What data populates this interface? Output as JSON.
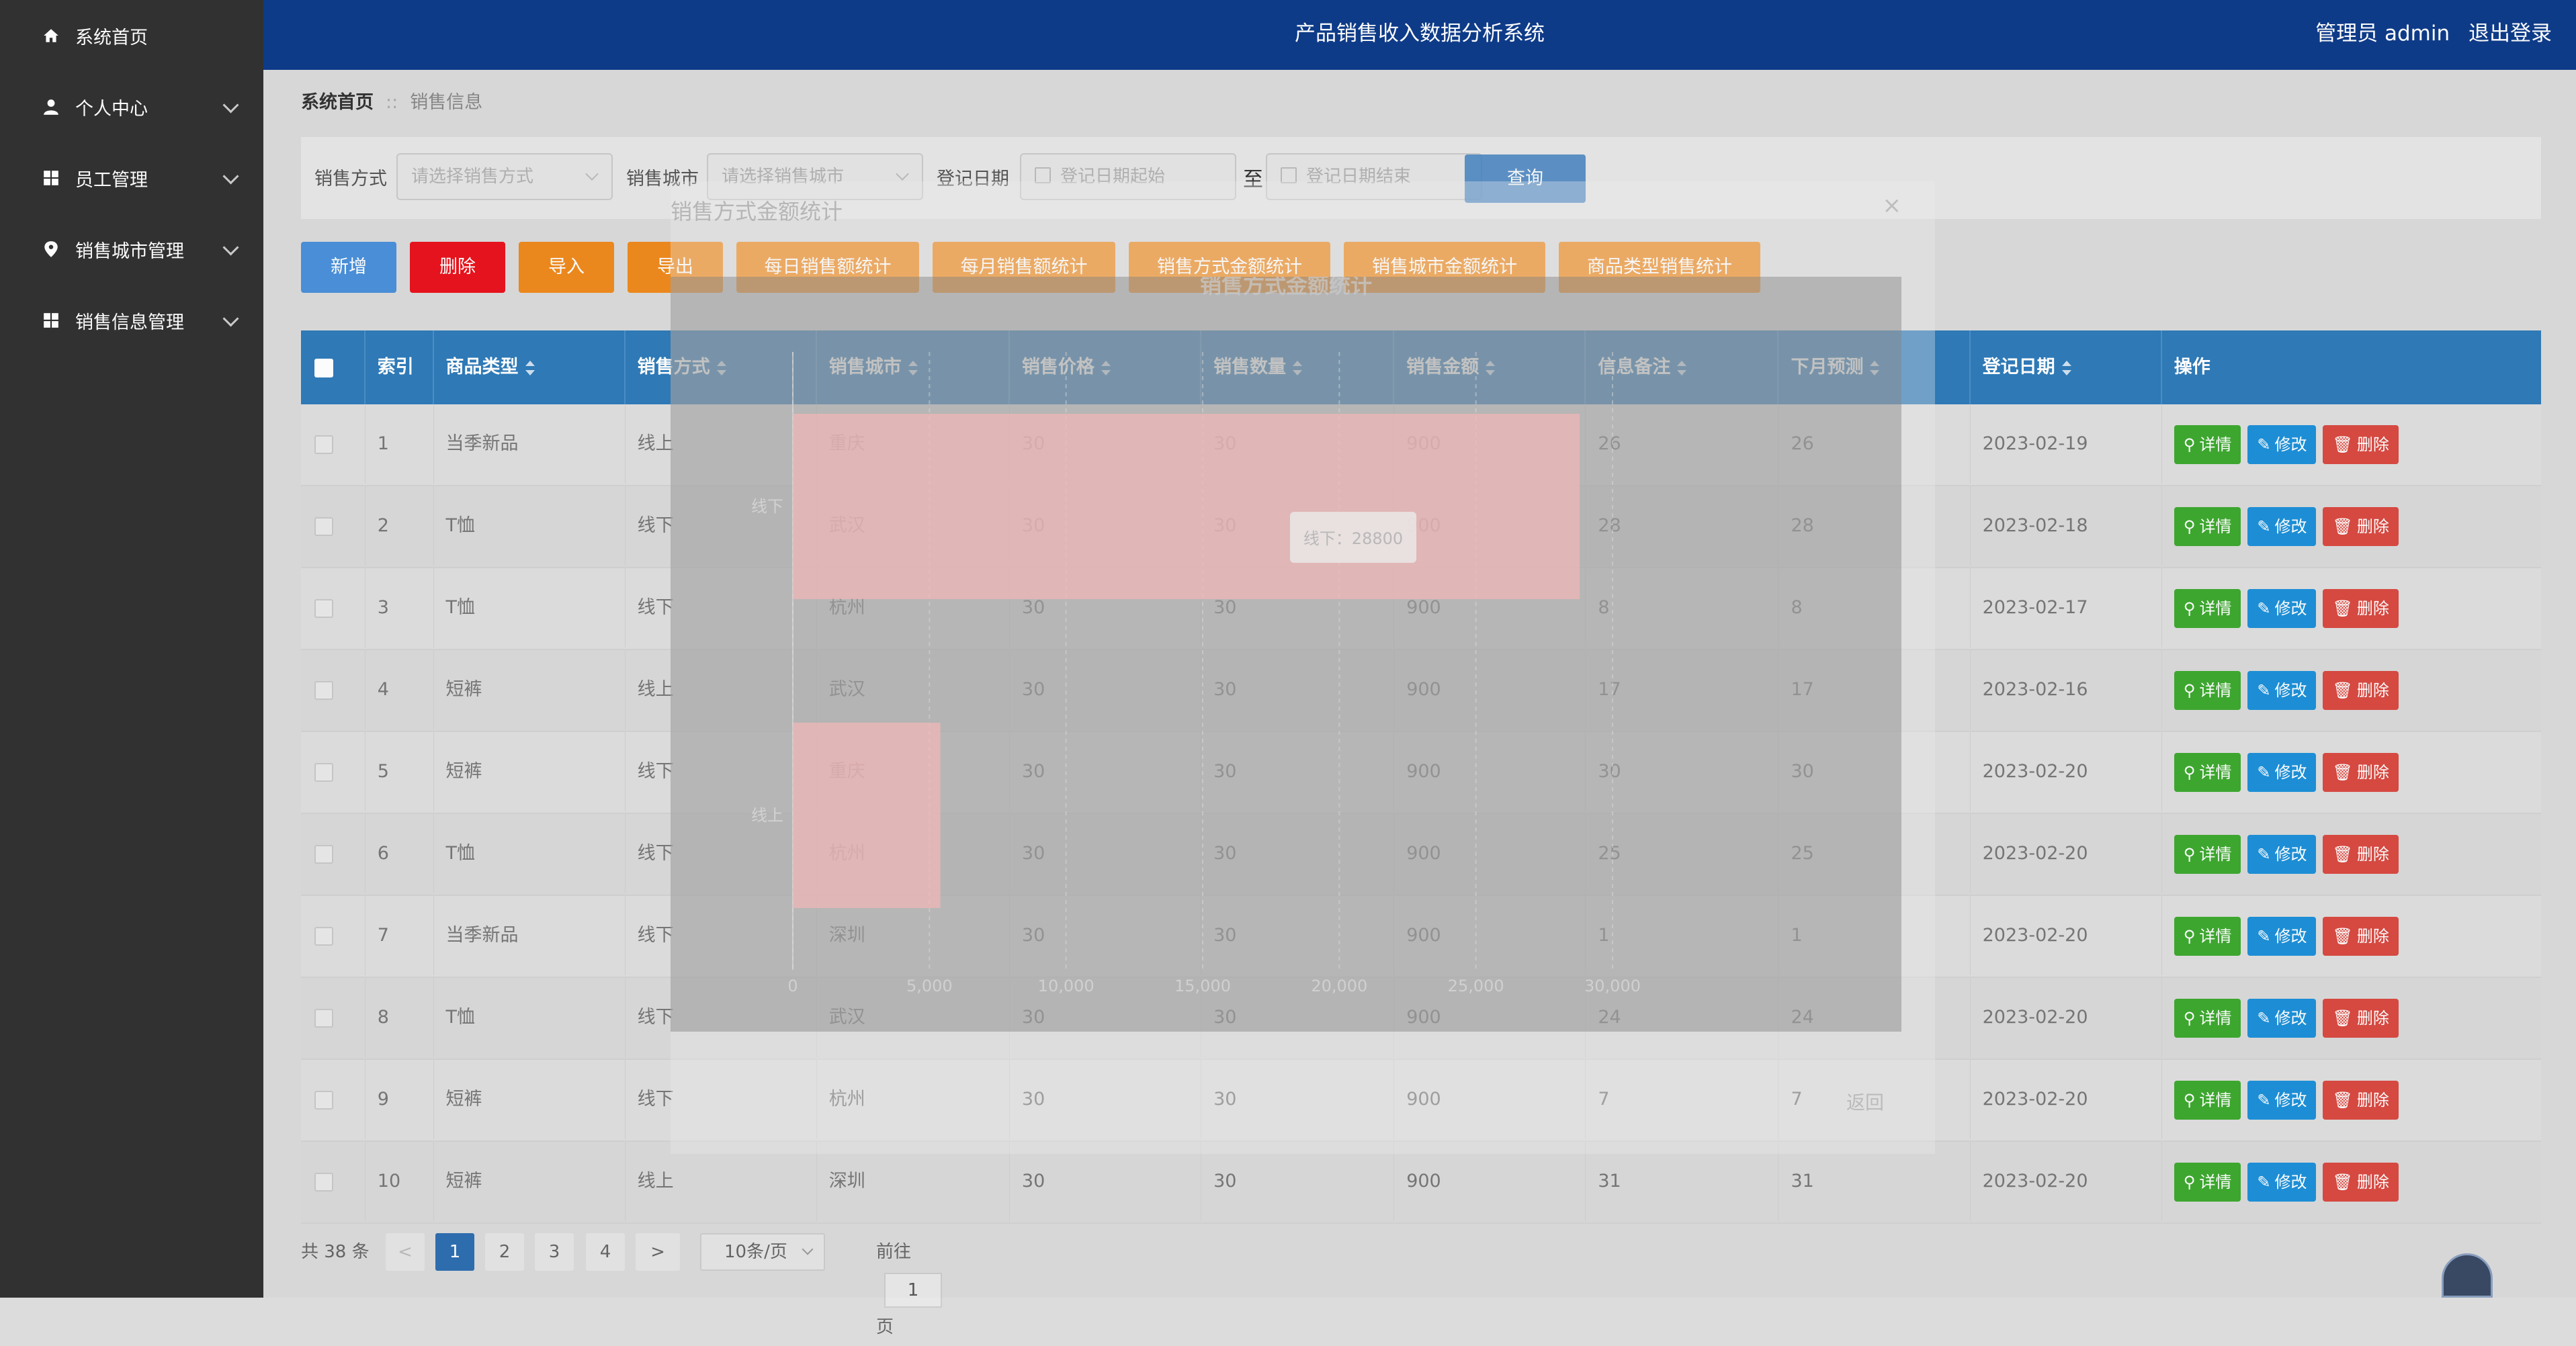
{
  "sidebar": {
    "items": [
      {
        "label": "系统首页",
        "icon": "home-icon"
      },
      {
        "label": "个人中心",
        "icon": "user-icon"
      },
      {
        "label": "员工管理",
        "icon": "grid-icon"
      },
      {
        "label": "销售城市管理",
        "icon": "location-pin-icon"
      },
      {
        "label": "销售信息管理",
        "icon": "grid-icon"
      }
    ]
  },
  "header": {
    "title": "产品销售收入数据分析系统",
    "user": "管理员 admin",
    "logout": "退出登录"
  },
  "breadcrumb": {
    "home": "系统首页",
    "separator": "::",
    "current": "销售信息"
  },
  "search": {
    "method_label": "销售方式",
    "method_placeholder": "请选择销售方式",
    "city_label": "销售城市",
    "city_placeholder": "请选择销售城市",
    "date_label": "登记日期",
    "date_start_placeholder": "登记日期起始",
    "date_to": "至",
    "date_end_placeholder": "登记日期结束",
    "query_button": "查询"
  },
  "toolbar": {
    "add": "新增",
    "delete": "删除",
    "import": "导入",
    "export": "导出",
    "daily_stats": "每日销售额统计",
    "monthly_stats": "每月销售额统计",
    "method_stats": "销售方式金额统计",
    "city_stats": "销售城市金额统计",
    "category_stats": "商品类型销售统计"
  },
  "table": {
    "headers": [
      "索引",
      "商品类型",
      "销售方式",
      "销售城市",
      "销售价格",
      "销售数量",
      "销售金额",
      "信息备注",
      "下月预测",
      "登记日期",
      "操作"
    ],
    "rows": [
      [
        "1",
        "当季新品",
        "线上",
        "重庆",
        "30",
        "30",
        "900",
        "26",
        "26",
        "2023-02-19"
      ],
      [
        "2",
        "T恤",
        "线下",
        "武汉",
        "30",
        "30",
        "900",
        "28",
        "28",
        "2023-02-18"
      ],
      [
        "3",
        "T恤",
        "线下",
        "杭州",
        "30",
        "30",
        "900",
        "8",
        "8",
        "2023-02-17"
      ],
      [
        "4",
        "短裤",
        "线上",
        "武汉",
        "30",
        "30",
        "900",
        "17",
        "17",
        "2023-02-16"
      ],
      [
        "5",
        "短裤",
        "线下",
        "重庆",
        "30",
        "30",
        "900",
        "30",
        "30",
        "2023-02-20"
      ],
      [
        "6",
        "T恤",
        "线下",
        "杭州",
        "30",
        "30",
        "900",
        "25",
        "25",
        "2023-02-20"
      ],
      [
        "7",
        "当季新品",
        "线下",
        "深圳",
        "30",
        "30",
        "900",
        "1",
        "1",
        "2023-02-20"
      ],
      [
        "8",
        "T恤",
        "线下",
        "武汉",
        "30",
        "30",
        "900",
        "24",
        "24",
        "2023-02-20"
      ],
      [
        "9",
        "短裤",
        "线下",
        "杭州",
        "30",
        "30",
        "900",
        "7",
        "7",
        "2023-02-20"
      ],
      [
        "10",
        "短裤",
        "线上",
        "深圳",
        "30",
        "30",
        "900",
        "31",
        "31",
        "2023-02-20"
      ]
    ],
    "actions": {
      "detail": "详情",
      "edit": "修改",
      "delete": "删除"
    }
  },
  "pagination": {
    "total": "共 38 条",
    "prev": "<",
    "pages": [
      "1",
      "2",
      "3",
      "4"
    ],
    "current": "1",
    "next": ">",
    "page_size": "10条/页",
    "goto_prefix": "前往",
    "goto_value": "1",
    "goto_suffix": "页"
  },
  "dialog": {
    "title": "销售方式金额统计",
    "close": "×",
    "back": "返回"
  },
  "chart_data": {
    "type": "bar",
    "orientation": "horizontal",
    "title": "销售方式金额统计",
    "categories": [
      "线下",
      "线上"
    ],
    "values": [
      28800,
      5400
    ],
    "xlim": [
      0,
      30000
    ],
    "xticks": [
      "0",
      "5,000",
      "10,000",
      "15,000",
      "20,000",
      "25,000",
      "30,000"
    ],
    "tooltip": "线下：28800",
    "bar_color": "#f4b6b6"
  },
  "colors": {
    "sidebar": "#323232",
    "header": "#0f3c8a",
    "table_header": "#2f7bb9",
    "add": "#4a90d9",
    "delete": "#e8141e",
    "orange": "#ee8a1e",
    "detail": "#3ea830",
    "edit": "#1e90d8",
    "remove": "#d84a42"
  }
}
